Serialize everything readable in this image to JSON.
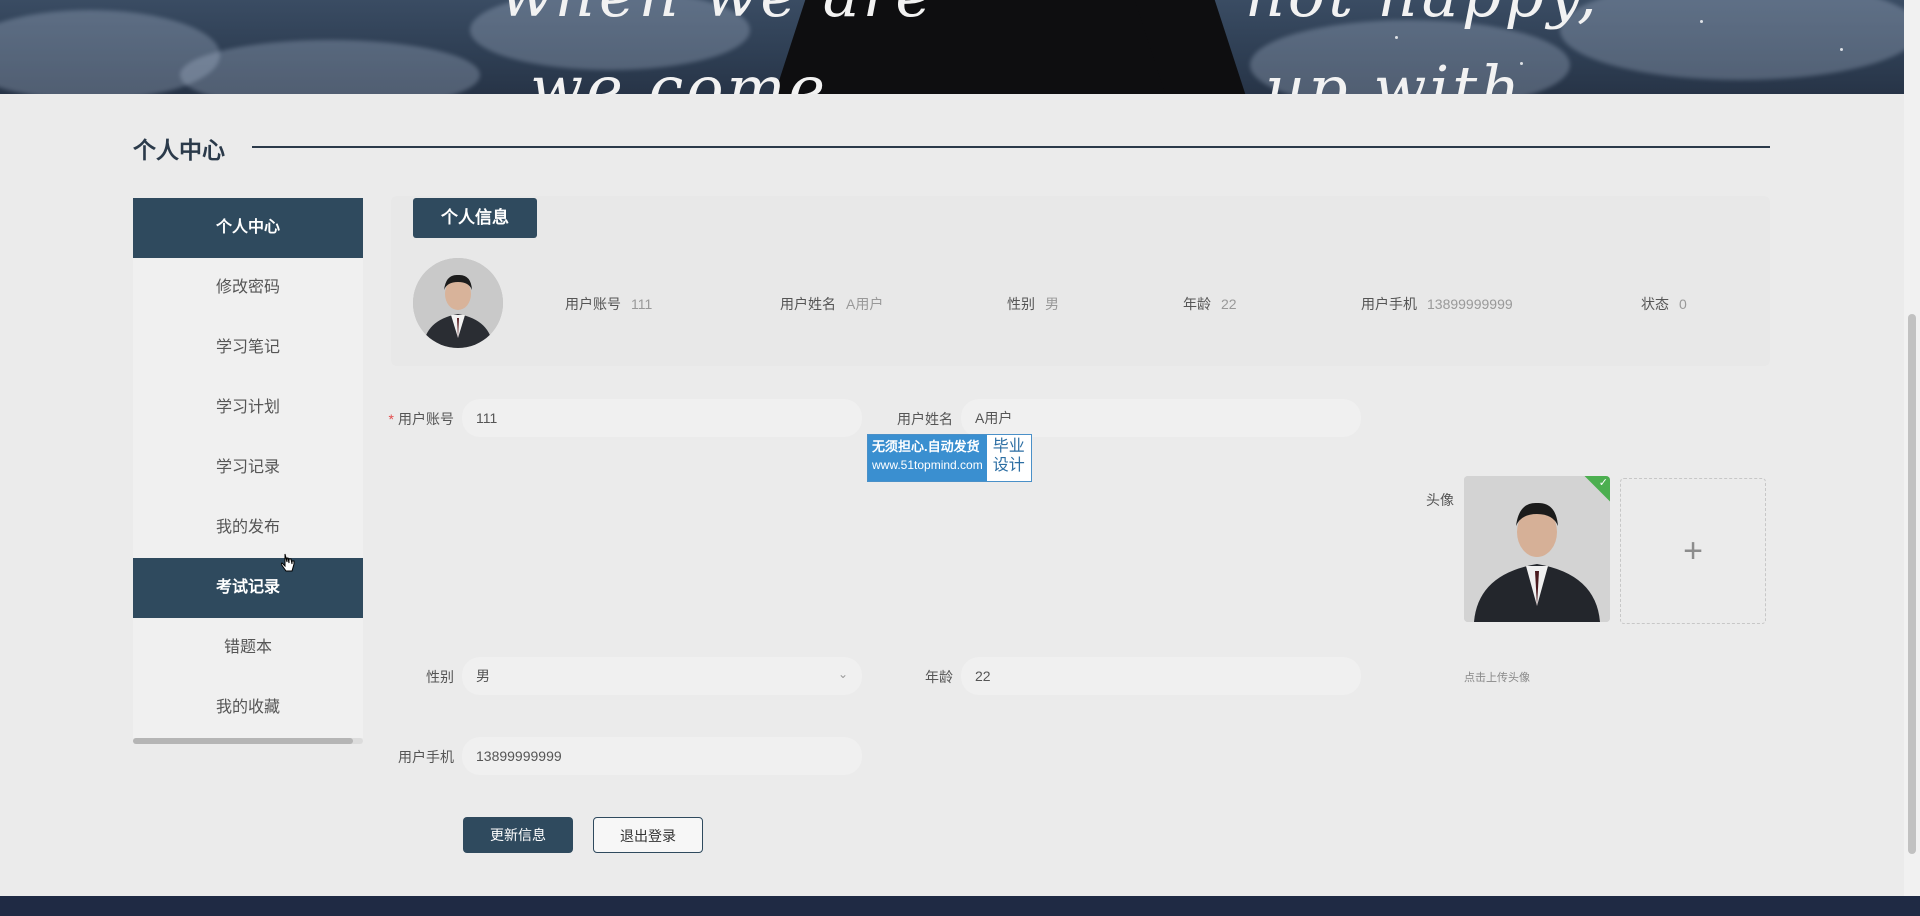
{
  "banner": {
    "text_line1": "when we are",
    "text_line1b": "not happy,",
    "text_line2": "we come",
    "text_line2b": "up with"
  },
  "section": {
    "title": "个人中心"
  },
  "sidebar": {
    "items": [
      {
        "label": "个人中心",
        "active": true
      },
      {
        "label": "修改密码",
        "active": false
      },
      {
        "label": "学习笔记",
        "active": false
      },
      {
        "label": "学习计划",
        "active": false
      },
      {
        "label": "学习记录",
        "active": false
      },
      {
        "label": "我的发布",
        "active": false
      },
      {
        "label": "考试记录",
        "active": true
      },
      {
        "label": "错题本",
        "active": false
      },
      {
        "label": "我的收藏",
        "active": false
      }
    ]
  },
  "info": {
    "tab_label": "个人信息",
    "fields": [
      {
        "key": "用户账号",
        "value": "111"
      },
      {
        "key": "用户姓名",
        "value": "A用户"
      },
      {
        "key": "性别",
        "value": "男"
      },
      {
        "key": "年龄",
        "value": "22"
      },
      {
        "key": "用户手机",
        "value": "13899999999"
      },
      {
        "key": "状态",
        "value": "0"
      }
    ]
  },
  "form": {
    "account": {
      "label": "用户账号",
      "required_mark": "*",
      "value": "111"
    },
    "name": {
      "label": "用户姓名",
      "value": "A用户"
    },
    "avatar": {
      "label": "头像",
      "upload_tip": "点击上传头像",
      "add_symbol": "+"
    },
    "gender": {
      "label": "性别",
      "value": "男"
    },
    "age": {
      "label": "年龄",
      "value": "22"
    },
    "phone": {
      "label": "用户手机",
      "value": "13899999999"
    },
    "update_button": "更新信息",
    "logout_button": "退出登录"
  },
  "watermark": {
    "line1": "无须担心.自动发货",
    "line2": "www.51topmind.com",
    "right1": "毕业",
    "right2": "设计"
  },
  "colors": {
    "primary": "#2f4a5e",
    "background": "#ebebeb",
    "required": "#e24b4b"
  }
}
